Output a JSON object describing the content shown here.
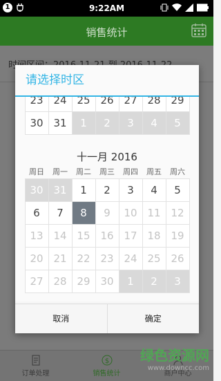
{
  "status_bar": {
    "time": "9:22AM",
    "notification_count": "1"
  },
  "app": {
    "title": "销售统计",
    "date_range_text": "时间区间：2016-11-21 到 2016-11-22"
  },
  "tabs": [
    {
      "label": "订单处理",
      "icon": "order-icon"
    },
    {
      "label": "销售统计",
      "icon": "dollar-icon"
    },
    {
      "label": "商户中心",
      "icon": "user-icon"
    }
  ],
  "dialog": {
    "title": "请选择时区",
    "cancel_label": "取消",
    "confirm_label": "确定",
    "prev_month_tail": [
      {
        "d": "23",
        "t": "n"
      },
      {
        "d": "24",
        "t": "n"
      },
      {
        "d": "25",
        "t": "n"
      },
      {
        "d": "26",
        "t": "n"
      },
      {
        "d": "27",
        "t": "n"
      },
      {
        "d": "28",
        "t": "n"
      },
      {
        "d": "29",
        "t": "n"
      },
      {
        "d": "30",
        "t": "n"
      },
      {
        "d": "31",
        "t": "n"
      },
      {
        "d": "1",
        "t": "g"
      },
      {
        "d": "2",
        "t": "g"
      },
      {
        "d": "3",
        "t": "g"
      },
      {
        "d": "4",
        "t": "g"
      },
      {
        "d": "5",
        "t": "g"
      }
    ],
    "month_title": "十一月 2016",
    "weekdays": [
      "周日",
      "周一",
      "周二",
      "周三",
      "周四",
      "周五",
      "周六"
    ],
    "days": [
      {
        "d": "30",
        "t": "g"
      },
      {
        "d": "31",
        "t": "g"
      },
      {
        "d": "1",
        "t": "n"
      },
      {
        "d": "2",
        "t": "n"
      },
      {
        "d": "3",
        "t": "n"
      },
      {
        "d": "4",
        "t": "n"
      },
      {
        "d": "5",
        "t": "n"
      },
      {
        "d": "6",
        "t": "n"
      },
      {
        "d": "7",
        "t": "n"
      },
      {
        "d": "8",
        "t": "s"
      },
      {
        "d": "9",
        "t": "d"
      },
      {
        "d": "10",
        "t": "d"
      },
      {
        "d": "11",
        "t": "d"
      },
      {
        "d": "12",
        "t": "d"
      },
      {
        "d": "13",
        "t": "d"
      },
      {
        "d": "14",
        "t": "d"
      },
      {
        "d": "15",
        "t": "d"
      },
      {
        "d": "16",
        "t": "d"
      },
      {
        "d": "17",
        "t": "d"
      },
      {
        "d": "18",
        "t": "d"
      },
      {
        "d": "19",
        "t": "d"
      },
      {
        "d": "20",
        "t": "d"
      },
      {
        "d": "21",
        "t": "d"
      },
      {
        "d": "22",
        "t": "d"
      },
      {
        "d": "23",
        "t": "d"
      },
      {
        "d": "24",
        "t": "d"
      },
      {
        "d": "25",
        "t": "d"
      },
      {
        "d": "26",
        "t": "d"
      },
      {
        "d": "27",
        "t": "d"
      },
      {
        "d": "28",
        "t": "d"
      },
      {
        "d": "29",
        "t": "d"
      },
      {
        "d": "30",
        "t": "d"
      },
      {
        "d": "1",
        "t": "g"
      },
      {
        "d": "2",
        "t": "g"
      },
      {
        "d": "3",
        "t": "g"
      }
    ]
  },
  "watermark": {
    "text": "绿色资源网",
    "url": "www.downcc.com"
  },
  "colors": {
    "accent": "#33b5e5",
    "header": "#2d7a23",
    "selected": "#707a84"
  }
}
